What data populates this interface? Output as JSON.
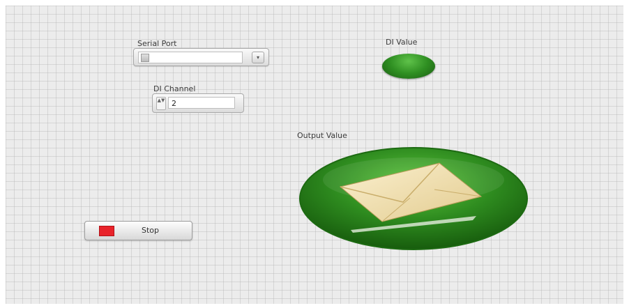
{
  "controls": {
    "serial_port": {
      "label": "Serial Port",
      "value": "",
      "dropdown_glyph": "▾",
      "icon": "io-resource-icon"
    },
    "di_channel": {
      "label": "DI Channel",
      "value": "2",
      "spinner_glyph": "▲▼"
    },
    "stop_button": {
      "label": "Stop",
      "led_color": "#e8232a"
    }
  },
  "indicators": {
    "di_value": {
      "label": "DI Value",
      "state": "on",
      "color": "#2f8f22"
    },
    "output_value": {
      "label": "Output Value",
      "icon": "envelope-icon",
      "color": "#2e8b1f"
    }
  },
  "colors": {
    "panel_background": "#ececec",
    "led_green": "#2f8f22",
    "stop_red": "#e8232a"
  }
}
